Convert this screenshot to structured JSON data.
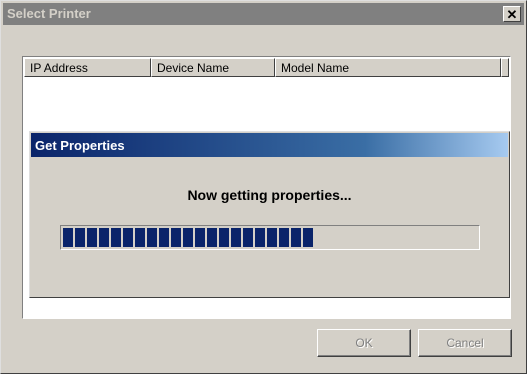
{
  "window": {
    "title": "Select Printer",
    "close_glyph": "✕"
  },
  "list": {
    "columns": [
      "IP Address",
      "Device Name",
      "Model Name"
    ]
  },
  "progress_dialog": {
    "title": "Get Properties",
    "message": "Now getting properties...",
    "progress_fraction": 0.61,
    "color_fill": "#0a246a"
  },
  "buttons": {
    "ok_label": "OK",
    "cancel_label": "Cancel"
  },
  "colors": {
    "face": "#d4d0c8",
    "inactive_title": "#808080",
    "active_title": "#0a246a"
  }
}
